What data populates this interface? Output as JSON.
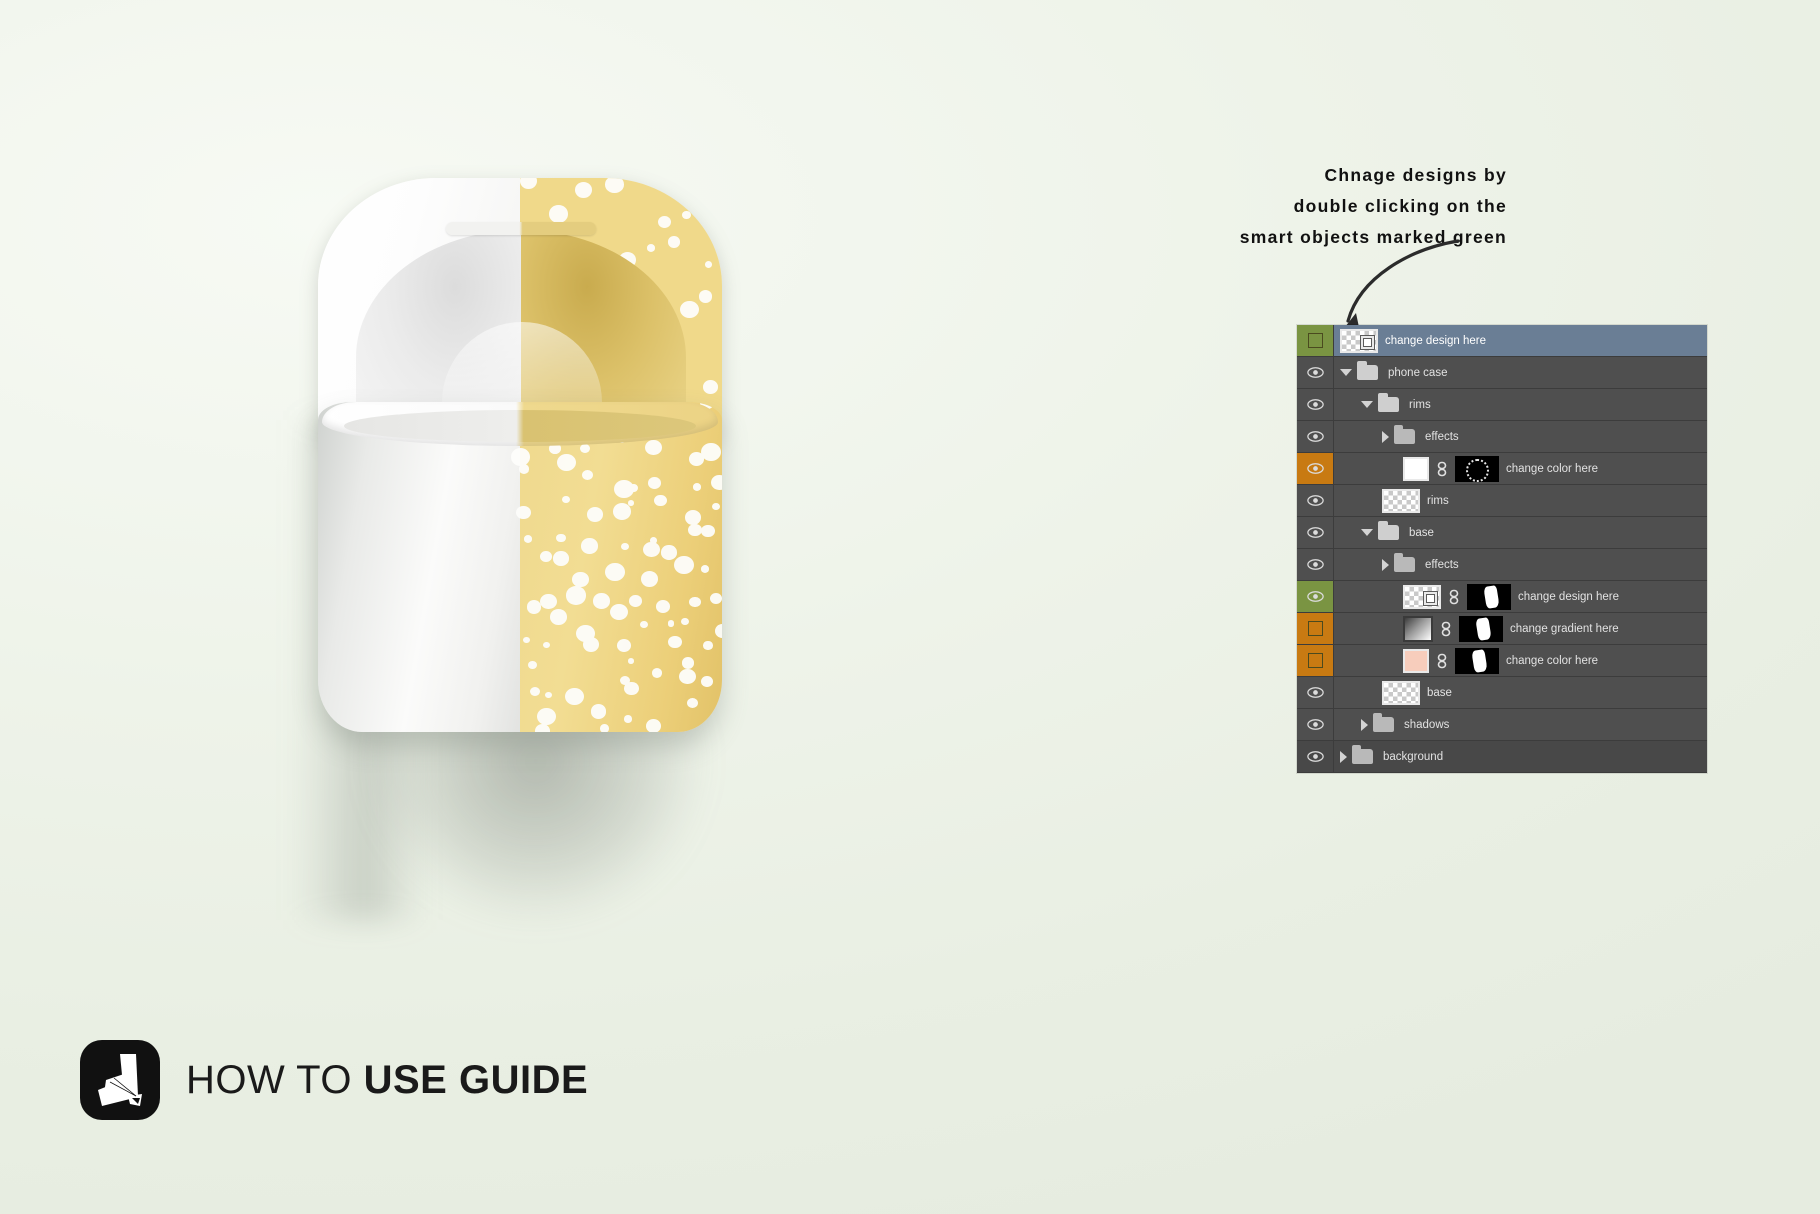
{
  "annotation": {
    "line1": "Chnage designs by",
    "line2": "double clicking  on the",
    "line3": "smart objects marked green"
  },
  "footer": {
    "title_light": "HOW TO ",
    "title_bold": "USE GUIDE",
    "logo_icon": "mockup-logo-icon"
  },
  "mockup": {
    "product": "wireless-earbuds-charging-case",
    "left_half_color": "#ffffff",
    "right_half_color": "#efd98e",
    "pattern_dot_color": "#fdfdfb",
    "background_color": "#eef3e9"
  },
  "layers_panel": {
    "selected_row_color": "#6a7e95",
    "smart_object_marker_color": "#7a9442",
    "editable_marker_color": "#c87a12",
    "panel_bg_color": "#4f4f4f",
    "rows": [
      {
        "name": "change design here",
        "indent": 0,
        "type": "smart-object",
        "marker": "green",
        "eye": "hidden",
        "thumb": "checker-smartobject",
        "link": false,
        "mask": false,
        "selected": true
      },
      {
        "name": "phone case",
        "indent": 0,
        "type": "group",
        "marker": "none",
        "eye": "visible",
        "twirl": "down",
        "folder": "open"
      },
      {
        "name": "rims",
        "indent": 1,
        "type": "group",
        "marker": "none",
        "eye": "visible",
        "twirl": "down",
        "folder": "open"
      },
      {
        "name": "effects",
        "indent": 2,
        "type": "group",
        "marker": "none",
        "eye": "visible",
        "twirl": "right",
        "folder": "closed"
      },
      {
        "name": "change color here",
        "indent": 3,
        "type": "fill-layer",
        "marker": "orange",
        "eye": "visible",
        "thumb": "solid-white",
        "link": true,
        "mask": "outline"
      },
      {
        "name": "rims",
        "indent": 2,
        "type": "pixel-layer",
        "marker": "none",
        "eye": "visible",
        "thumb": "checker"
      },
      {
        "name": "base",
        "indent": 1,
        "type": "group",
        "marker": "none",
        "eye": "visible",
        "twirl": "down",
        "folder": "open"
      },
      {
        "name": "effects",
        "indent": 2,
        "type": "group",
        "marker": "none",
        "eye": "visible",
        "twirl": "right",
        "folder": "closed"
      },
      {
        "name": "change design here",
        "indent": 3,
        "type": "smart-object",
        "marker": "green",
        "eye": "visible",
        "thumb": "checker-smartobject",
        "link": true,
        "mask": "shape"
      },
      {
        "name": "change gradient here",
        "indent": 3,
        "type": "gradient-layer",
        "marker": "orange",
        "eye": "hidden",
        "thumb": "gradient",
        "link": true,
        "mask": "shape"
      },
      {
        "name": "change color here",
        "indent": 3,
        "type": "fill-layer",
        "marker": "orange",
        "eye": "hidden",
        "thumb": "solid-pink",
        "link": true,
        "mask": "shape"
      },
      {
        "name": "base",
        "indent": 2,
        "type": "pixel-layer",
        "marker": "none",
        "eye": "visible",
        "thumb": "checker"
      },
      {
        "name": "shadows",
        "indent": 1,
        "type": "group",
        "marker": "none",
        "eye": "visible",
        "twirl": "right",
        "folder": "closed"
      },
      {
        "name": "background",
        "indent": 0,
        "type": "group",
        "marker": "none",
        "eye": "visible",
        "twirl": "right",
        "folder": "closed",
        "dim": true
      }
    ]
  }
}
